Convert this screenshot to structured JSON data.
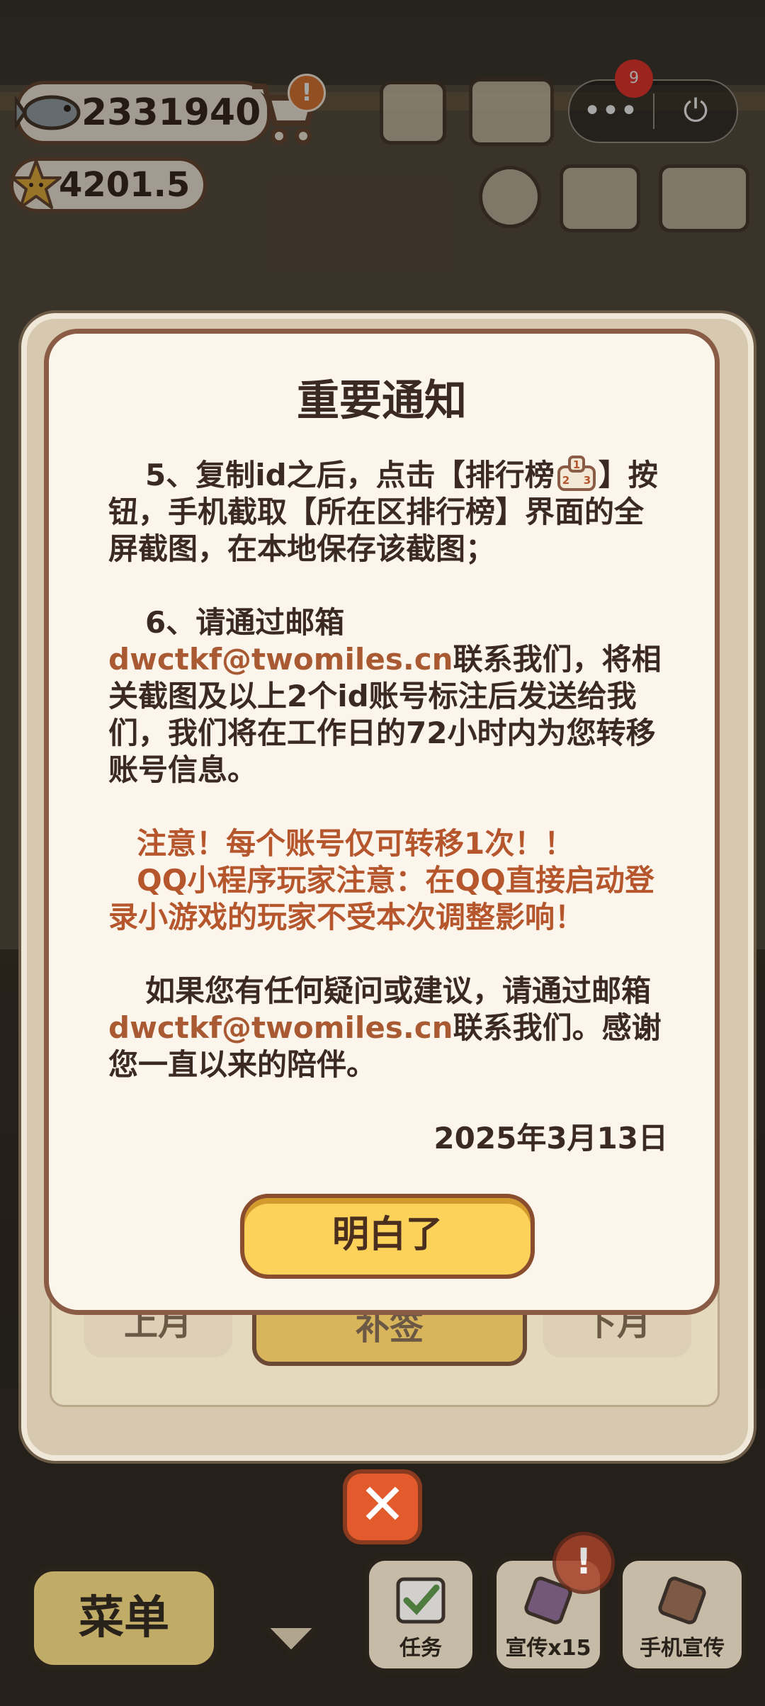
{
  "hud": {
    "fish_count": "2331940",
    "star_count": "4201.5",
    "cart_alert": "!",
    "notification_count": "9",
    "more_label": "•••",
    "power_label": "⏻"
  },
  "dialog": {
    "title": "重要通知",
    "step5_before": "5、复制id之后，点击【排行榜",
    "step5_after": "】按钮，手机截取【所在区排行榜】界面的全屏截图，在本地保存该截图；",
    "step6_intro": "6、请通过邮箱",
    "email": "dwctkf@twomiles.cn",
    "step6_rest": "联系我们，将相关截图及以上2个id账号标注后发送给我们，我们将在工作日的72小时内为您转移账号信息。",
    "warn1": "注意！每个账号仅可转移1次！！",
    "warn2": "QQ小程序玩家注意：在QQ直接启动登录小游戏的玩家不受本次调整影响！",
    "contact_before": "如果您有任何疑问或建议，请通过邮箱",
    "contact_after": "联系我们。感谢您一直以来的陪伴。",
    "date": "2025年3月13日",
    "confirm_button": "明白了"
  },
  "background_panel": {
    "prev_month": "上月",
    "sign_button": "补签",
    "next_month": "下月"
  },
  "bottom_bar": {
    "menu": "菜单",
    "tasks": "任务",
    "promote": "宣传x15",
    "phone_promote": "手机宣传",
    "promote_alert": "!"
  },
  "close_label": "✕",
  "colors": {
    "dialog_bg": "#fcf5ec",
    "dialog_border": "#8a5c45",
    "link": "#a95a32",
    "warning": "#b5562d",
    "button_yellow": "#fdd25a",
    "close_orange": "#e35a2c",
    "badge_red": "#ee3a2e"
  }
}
